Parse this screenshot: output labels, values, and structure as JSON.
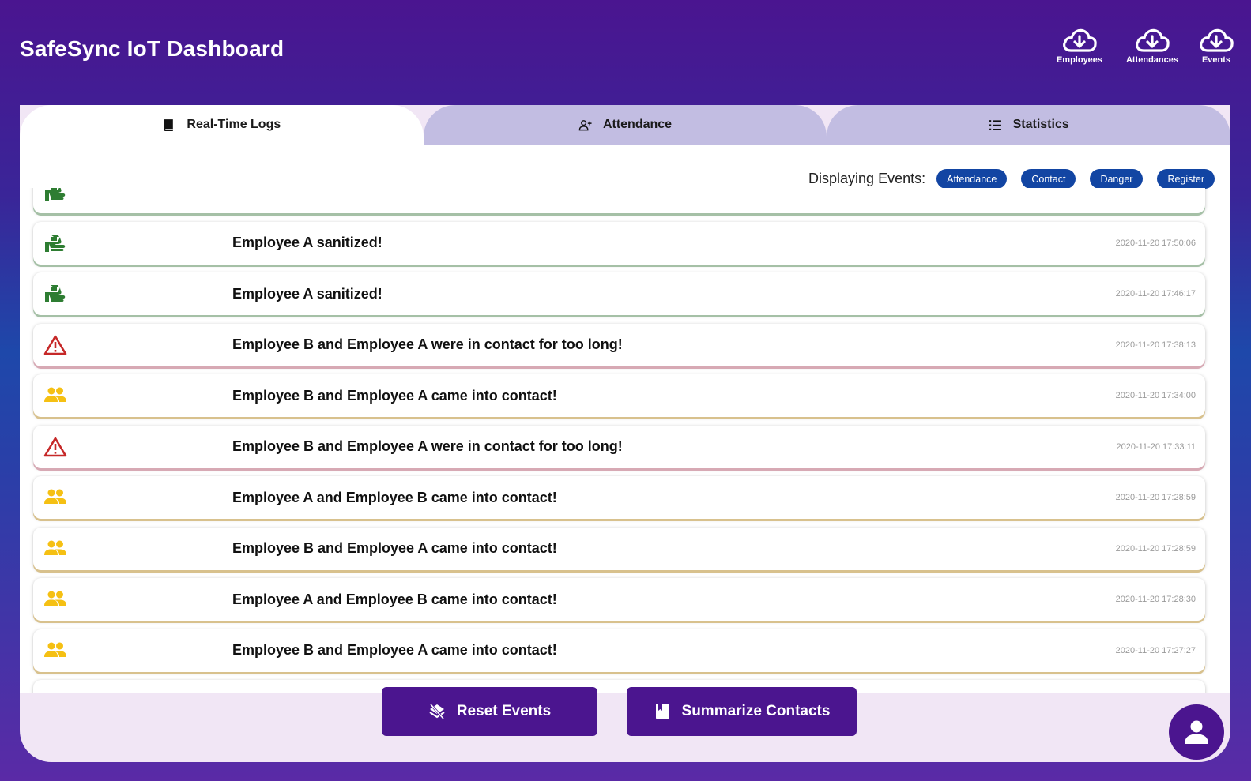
{
  "app": {
    "title": "SafeSync IoT Dashboard"
  },
  "downloads": [
    {
      "label": "Employees",
      "icon": "cloud-download-icon"
    },
    {
      "label": "Attendances",
      "icon": "cloud-download-icon"
    },
    {
      "label": "Events",
      "icon": "cloud-download-icon"
    }
  ],
  "tabs": [
    {
      "label": "Real-Time Logs",
      "icon": "book-icon",
      "active": true
    },
    {
      "label": "Attendance",
      "icon": "person-add-icon",
      "active": false
    },
    {
      "label": "Statistics",
      "icon": "list-icon",
      "active": false
    }
  ],
  "filter": {
    "label": "Displaying Events:",
    "chips": [
      "Attendance",
      "Contact",
      "Danger",
      "Register"
    ]
  },
  "logs": [
    {
      "type": "sanitize",
      "icon": "hand-sanitize-icon",
      "message": "",
      "time": ""
    },
    {
      "type": "sanitize",
      "icon": "hand-sanitize-icon",
      "message": "Employee A sanitized!",
      "time": "2020-11-20 17:50:06"
    },
    {
      "type": "sanitize",
      "icon": "hand-sanitize-icon",
      "message": "Employee A sanitized!",
      "time": "2020-11-20 17:46:17"
    },
    {
      "type": "danger",
      "icon": "warning-icon",
      "message": "Employee B and Employee A were in contact for too long!",
      "time": "2020-11-20 17:38:13"
    },
    {
      "type": "contact",
      "icon": "people-icon",
      "message": "Employee B and Employee A came into contact!",
      "time": "2020-11-20 17:34:00"
    },
    {
      "type": "danger",
      "icon": "warning-icon",
      "message": "Employee B and Employee A were in contact for too long!",
      "time": "2020-11-20 17:33:11"
    },
    {
      "type": "contact",
      "icon": "people-icon",
      "message": "Employee A and Employee B came into contact!",
      "time": "2020-11-20 17:28:59"
    },
    {
      "type": "contact",
      "icon": "people-icon",
      "message": "Employee B and Employee A came into contact!",
      "time": "2020-11-20 17:28:59"
    },
    {
      "type": "contact",
      "icon": "people-icon",
      "message": "Employee A and Employee B came into contact!",
      "time": "2020-11-20 17:28:30"
    },
    {
      "type": "contact",
      "icon": "people-icon",
      "message": "Employee B and Employee A came into contact!",
      "time": "2020-11-20 17:27:27"
    },
    {
      "type": "contact",
      "icon": "people-icon",
      "message": "",
      "time": ""
    }
  ],
  "actions": {
    "reset_label": "Reset Events",
    "summarize_label": "Summarize Contacts"
  },
  "colors": {
    "primary": "#4b158f",
    "chip": "#1245a3",
    "sanitize": "#2e7d32",
    "danger": "#c62828",
    "contact": "#f5c013"
  }
}
